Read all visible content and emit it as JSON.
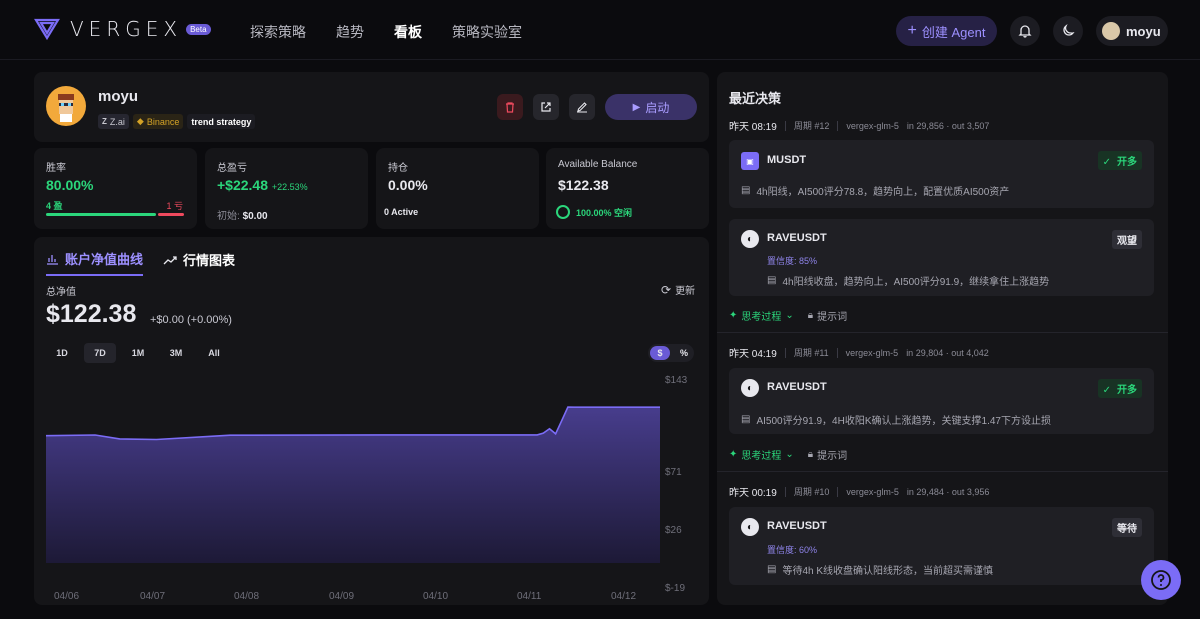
{
  "brand": {
    "name": "VERGEX",
    "beta": "Beta"
  },
  "nav": [
    {
      "label": "探索策略"
    },
    {
      "label": "趋势"
    },
    {
      "label": "看板"
    },
    {
      "label": "策略实验室"
    }
  ],
  "header": {
    "create_label": "创建 Agent",
    "username": "moyu"
  },
  "profile": {
    "name": "moyu",
    "tags": [
      "Z.ai",
      "Binance",
      "trend strategy"
    ],
    "start_label": "启动"
  },
  "stats": {
    "winrate": {
      "label": "胜率",
      "value": "80.00%",
      "wins": "4 盈",
      "losses": "1 亏",
      "win_fraction": 0.8
    },
    "pnl": {
      "label": "总盈亏",
      "value": "+$22.48",
      "pct": "+22.53%",
      "initial_label": "初始:",
      "initial_value": "$0.00"
    },
    "position": {
      "label": "持仓",
      "value": "0.00%",
      "active": "0 Active"
    },
    "balance": {
      "label": "Available Balance",
      "value": "$122.38",
      "idle": "100.00% 空闲"
    }
  },
  "chart_panel": {
    "tab_equity": "账户净值曲线",
    "tab_market": "行情图表",
    "net_label": "总净值",
    "net_value": "$122.38",
    "net_change": "+$0.00 (+0.00%)",
    "refresh": "更新",
    "ranges": [
      "1D",
      "7D",
      "1M",
      "3M",
      "All"
    ],
    "unit_dollar": "$",
    "unit_pct": "%"
  },
  "chart_data": {
    "type": "area",
    "x_labels": [
      "04/06",
      "04/07",
      "04/08",
      "04/09",
      "04/10",
      "04/11",
      "04/12"
    ],
    "y_ticks": [
      "$143",
      "$71",
      "$26",
      "$-19"
    ],
    "ylim": [
      -19,
      143
    ],
    "series": [
      {
        "x": [
          0,
          0.08,
          0.12,
          0.18,
          0.3,
          0.55,
          0.8,
          0.81,
          0.82,
          0.83,
          0.84,
          0.85,
          0.86,
          1.0
        ],
        "values": [
          100.0,
          100.5,
          97.5,
          97.0,
          100.4,
          100.6,
          100.6,
          102.0,
          105.5,
          101.5,
          112.0,
          122.5,
          122.4,
          122.4
        ]
      }
    ],
    "color": "#7b6cf6"
  },
  "decisions": {
    "title": "最近决策",
    "groups": [
      {
        "when": "昨天 08:19",
        "cycle": "周期 #12",
        "model": "vergex-glm-5",
        "tokens": "in 29,856 · out 3,507",
        "items": [
          {
            "symbol": "MUSDT",
            "badge": "开多",
            "reason": "4h阳线，AI500评分78.8，趋势向上，配置优质AI500资产"
          },
          {
            "symbol": "RAVEUSDT",
            "badge": "观望",
            "confidence": "置信度: 85%",
            "reason": "4h阳线收盘，趋势向上，AI500评分91.9，继续拿住上涨趋势"
          }
        ],
        "think": "思考过程",
        "prompt": "提示词"
      },
      {
        "when": "昨天 04:19",
        "cycle": "周期 #11",
        "model": "vergex-glm-5",
        "tokens": "in 29,804 · out 4,042",
        "items": [
          {
            "symbol": "RAVEUSDT",
            "badge": "开多",
            "reason": "AI500评分91.9，4H收阳K确认上涨趋势，关键支撑1.47下方设止损"
          }
        ],
        "think": "思考过程",
        "prompt": "提示词"
      },
      {
        "when": "昨天 00:19",
        "cycle": "周期 #10",
        "model": "vergex-glm-5",
        "tokens": "in 29,484 · out 3,956",
        "items": [
          {
            "symbol": "RAVEUSDT",
            "badge": "等待",
            "confidence": "置信度: 60%",
            "reason": "等待4h K线收盘确认阳线形态，当前超买需谨慎"
          }
        ]
      }
    ]
  },
  "colors": {
    "accent": "#7b6cf6",
    "green": "#2bd67b",
    "red": "#ef4a5e"
  }
}
